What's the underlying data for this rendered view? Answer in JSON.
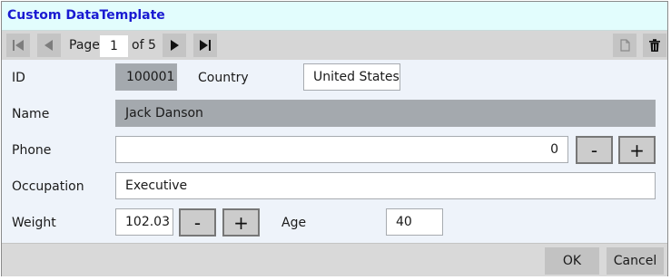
{
  "window": {
    "title": "Custom DataTemplate"
  },
  "pager": {
    "page_label": "Page",
    "current_page": "1",
    "total_label": "of 5",
    "icons": {
      "first": "first-page-icon",
      "prev": "previous-page-icon",
      "next": "next-page-icon",
      "last": "last-page-icon",
      "new": "new-record-icon",
      "delete": "delete-icon"
    }
  },
  "form": {
    "id": {
      "label": "ID",
      "value": "100001"
    },
    "country": {
      "label": "Country",
      "value": "United States"
    },
    "name": {
      "label": "Name",
      "value": "Jack Danson"
    },
    "phone": {
      "label": "Phone",
      "value": "0",
      "minus": "-",
      "plus": "+"
    },
    "occupation": {
      "label": "Occupation",
      "value": "Executive"
    },
    "weight": {
      "label": "Weight",
      "value": "102.03",
      "minus": "-",
      "plus": "+"
    },
    "age": {
      "label": "Age",
      "value": "40"
    }
  },
  "footer": {
    "ok_label": "OK",
    "cancel_label": "Cancel"
  },
  "colors": {
    "title_text": "#1a1ad2",
    "title_bg": "#e2fdfd",
    "readonly_field": "#a4a9ae",
    "form_bg": "#eef3fa"
  }
}
